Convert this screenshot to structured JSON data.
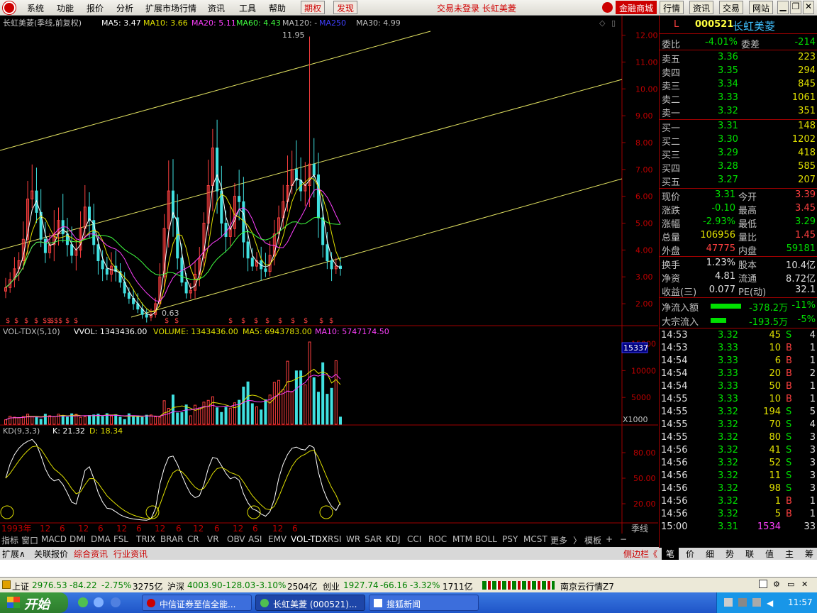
{
  "menu": {
    "items": [
      "系统",
      "功能",
      "报价",
      "分析",
      "扩展市场行情",
      "资讯",
      "工具",
      "帮助"
    ],
    "qiquan": "期权",
    "faxian": "发现",
    "center_text": "交易未登录  长虹美菱",
    "right_buttons": [
      "金融商城",
      "行情",
      "资讯",
      "交易",
      "网站"
    ]
  },
  "chart_header": {
    "title": "长虹美菱(季线,前复权)",
    "ma5": "MA5: 3.47",
    "ma10": "MA10: 3.66",
    "ma20": "MA20: 5.11",
    "ma60": "MA60: 4.43",
    "ma120": "MA120: -",
    "ma250": "MA250",
    "ma30": "MA30: 4.99",
    "high_label": "11.95",
    "low_label": "0.63"
  },
  "price_axis": [
    "12.00",
    "11.00",
    "10.00",
    "9.00",
    "8.00",
    "7.00",
    "6.00",
    "5.00",
    "4.00",
    "3.00",
    "2.00"
  ],
  "vol_header": {
    "title": "VOL-TDX(5,10)",
    "vvol": "VVOL: 1343436.00",
    "volume": "VOLUME: 1343436.00",
    "ma5": "MA5: 6943783.00",
    "ma10": "MA10: 5747174.50"
  },
  "vol_axis": [
    "15000",
    "10000",
    "5000"
  ],
  "vol_highlight": "15337",
  "vol_unit": "X1000",
  "kd_header": {
    "title": "KD(9,3,3)",
    "k": "K: 21.32",
    "d": "D: 18.34"
  },
  "kd_axis": [
    "80.00",
    "50.00",
    "20.00"
  ],
  "time_axis": [
    "1993年",
    "12",
    "6",
    "12",
    "6",
    "12",
    "6",
    "12",
    "6",
    "12",
    "6",
    "12",
    "6",
    "12",
    "6"
  ],
  "time_axis_right": "季线",
  "indicator_tabs": [
    "指标",
    "窗口",
    "MACD",
    "DMI",
    "DMA",
    "FSL",
    "TRIX",
    "BRAR",
    "CR",
    "VR",
    "OBV",
    "ASI",
    "EMV",
    "VOL-TDX",
    "RSI",
    "WR",
    "SAR",
    "KDJ",
    "CCI",
    "ROC",
    "MTM",
    "BOLL",
    "PSY",
    "MCST",
    "更多",
    "〉",
    "模板",
    "+",
    "−"
  ],
  "bottom_tabs": [
    "扩展∧",
    "关联报价",
    "综合资讯",
    "行业资讯"
  ],
  "side_tabs": {
    "label": "侧边栏《",
    "items": [
      "笔",
      "价",
      "细",
      "势",
      "联",
      "值",
      "主",
      "筹"
    ]
  },
  "quote": {
    "flag": "L",
    "code": "000521",
    "name": "长虹美菱",
    "weibi_label": "委比",
    "weibi": "-4.01%",
    "weicha_label": "委差",
    "weicha": "-214",
    "sell": [
      {
        "label": "卖五",
        "price": "3.36",
        "vol": "223"
      },
      {
        "label": "卖四",
        "price": "3.35",
        "vol": "294"
      },
      {
        "label": "卖三",
        "price": "3.34",
        "vol": "845"
      },
      {
        "label": "卖二",
        "price": "3.33",
        "vol": "1061"
      },
      {
        "label": "卖一",
        "price": "3.32",
        "vol": "351"
      }
    ],
    "buy": [
      {
        "label": "买一",
        "price": "3.31",
        "vol": "148"
      },
      {
        "label": "买二",
        "price": "3.30",
        "vol": "1202"
      },
      {
        "label": "买三",
        "price": "3.29",
        "vol": "418"
      },
      {
        "label": "买四",
        "price": "3.28",
        "vol": "585"
      },
      {
        "label": "买五",
        "price": "3.27",
        "vol": "207"
      }
    ],
    "stats": [
      {
        "l1": "现价",
        "v1": "3.31",
        "c1": "#00e000",
        "l2": "今开",
        "v2": "3.39",
        "c2": "#ff4040"
      },
      {
        "l1": "涨跌",
        "v1": "-0.10",
        "c1": "#00e000",
        "l2": "最高",
        "v2": "3.45",
        "c2": "#ff4040"
      },
      {
        "l1": "涨幅",
        "v1": "-2.93%",
        "c1": "#00e000",
        "l2": "最低",
        "v2": "3.29",
        "c2": "#00e000"
      },
      {
        "l1": "总量",
        "v1": "106956",
        "c1": "#e0e000",
        "l2": "量比",
        "v2": "1.45",
        "c2": "#ff4040"
      },
      {
        "l1": "外盘",
        "v1": "47775",
        "c1": "#ff4040",
        "l2": "内盘",
        "v2": "59181",
        "c2": "#00e000"
      }
    ],
    "stats2": [
      {
        "l1": "换手",
        "v1": "1.23%",
        "l2": "股本",
        "v2": "10.4亿"
      },
      {
        "l1": "净资",
        "v1": "4.81",
        "l2": "流通",
        "v2": "8.72亿"
      },
      {
        "l1": "收益(三)",
        "v1": "0.077",
        "l2": "PE(动)",
        "v2": "32.1"
      }
    ],
    "flow": [
      {
        "label": "净流入额",
        "value": "-378.2万",
        "pct": "-11%",
        "bar": 0.6
      },
      {
        "label": "大宗流入",
        "value": "-193.5万",
        "pct": "-5%",
        "bar": 0.3
      }
    ]
  },
  "ticks": [
    {
      "t": "14:53",
      "p": "3.32",
      "pc": "#00e000",
      "v": "45",
      "s": "S",
      "n": "4"
    },
    {
      "t": "14:53",
      "p": "3.33",
      "pc": "#00e000",
      "v": "10",
      "s": "B",
      "n": "1"
    },
    {
      "t": "14:54",
      "p": "3.33",
      "pc": "#00e000",
      "v": "6",
      "s": "B",
      "n": "1"
    },
    {
      "t": "14:54",
      "p": "3.33",
      "pc": "#00e000",
      "v": "20",
      "s": "B",
      "n": "2"
    },
    {
      "t": "14:54",
      "p": "3.33",
      "pc": "#00e000",
      "v": "50",
      "s": "B",
      "n": "1"
    },
    {
      "t": "14:55",
      "p": "3.33",
      "pc": "#00e000",
      "v": "10",
      "s": "B",
      "n": "1"
    },
    {
      "t": "14:55",
      "p": "3.32",
      "pc": "#00e000",
      "v": "194",
      "s": "S",
      "n": "5"
    },
    {
      "t": "14:55",
      "p": "3.32",
      "pc": "#00e000",
      "v": "70",
      "s": "S",
      "n": "4"
    },
    {
      "t": "14:55",
      "p": "3.32",
      "pc": "#00e000",
      "v": "80",
      "s": "S",
      "n": "3"
    },
    {
      "t": "14:56",
      "p": "3.32",
      "pc": "#00e000",
      "v": "41",
      "s": "S",
      "n": "3"
    },
    {
      "t": "14:56",
      "p": "3.32",
      "pc": "#00e000",
      "v": "52",
      "s": "S",
      "n": "3"
    },
    {
      "t": "14:56",
      "p": "3.32",
      "pc": "#00e000",
      "v": "11",
      "s": "S",
      "n": "3"
    },
    {
      "t": "14:56",
      "p": "3.32",
      "pc": "#00e000",
      "v": "98",
      "s": "S",
      "n": "3"
    },
    {
      "t": "14:56",
      "p": "3.32",
      "pc": "#00e000",
      "v": "1",
      "s": "B",
      "n": "1"
    },
    {
      "t": "14:56",
      "p": "3.32",
      "pc": "#00e000",
      "v": "5",
      "s": "B",
      "n": "1"
    },
    {
      "t": "15:00",
      "p": "3.31",
      "pc": "#00e000",
      "v": "1534",
      "s": "",
      "n": "33"
    }
  ],
  "status": {
    "sh_label": "上证",
    "sh_val": "2976.53",
    "sh_chg": "-84.22",
    "sh_pct": "-2.75%",
    "sh_amt": "3275亿",
    "sz_label": "沪深",
    "sz_val": "4003.90",
    "sz_chg": "-128.03",
    "sz_pct": "-3.10%",
    "sz_amt": "2504亿",
    "cy_label": "创业",
    "cy_val": "1927.74",
    "cy_chg": "-66.16",
    "cy_pct": "-3.32%",
    "cy_amt": "1711亿",
    "server": "南京云行情Z7"
  },
  "taskbar": {
    "start": "开始",
    "items": [
      "中信证券至信全能...",
      "长虹美菱 (000521)...",
      "搜狐新闻"
    ],
    "clock": "11:57"
  },
  "chart_data": {
    "type": "candlestick",
    "period": "quarterly",
    "x_start": "1993年",
    "price_ylim": [
      1.5,
      12.2
    ],
    "high": 11.95,
    "low": 0.63,
    "close_series": [
      2.6,
      2.9,
      3.3,
      3.6,
      4.4,
      5.9,
      6.2,
      5.4,
      4.4,
      3.9,
      4.2,
      4.6,
      5.1,
      4.6,
      4.2,
      3.8,
      4.0,
      4.8,
      5.6,
      5.1,
      4.2,
      3.6,
      3.3,
      3.1,
      3.4,
      3.2,
      2.8,
      2.4,
      2.2,
      2.0,
      1.8,
      1.6,
      1.5,
      1.6,
      2.0,
      3.0,
      4.8,
      6.2,
      5.2,
      3.7,
      2.8,
      2.4,
      2.5,
      3.1,
      3.7,
      5.0,
      6.4,
      7.8,
      6.2,
      5.0,
      4.5,
      4.8,
      6.0,
      5.8,
      4.3,
      3.7,
      3.4,
      3.6,
      3.3,
      3.2,
      3.8,
      4.6,
      5.2,
      5.8,
      6.4,
      7.0,
      6.6,
      6.2,
      6.4,
      7.2,
      6.8,
      5.2,
      4.2,
      3.6,
      3.3,
      3.4,
      3.31
    ],
    "ma_values": {
      "MA5": 3.47,
      "MA10": 3.66,
      "MA20": 5.11,
      "MA60": 4.43,
      "MA30": 4.99
    },
    "volume_ylim": [
      0,
      16000
    ],
    "kd": {
      "K": 21.32,
      "D": 18.34,
      "ylim": [
        0,
        100
      ]
    }
  }
}
